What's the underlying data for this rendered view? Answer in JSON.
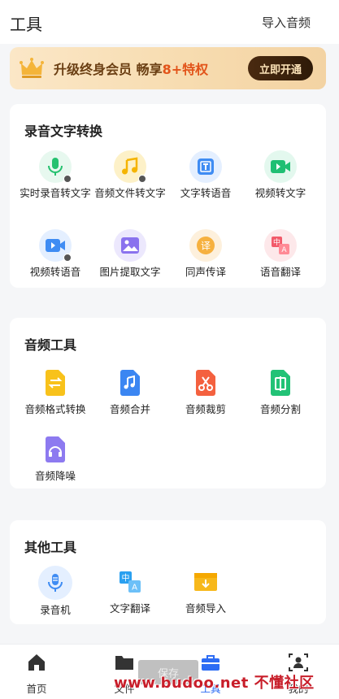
{
  "header": {
    "title": "工具",
    "import_label": "导入音频"
  },
  "banner": {
    "text_a": "升级终身会员 畅享",
    "text_b": "8+特权",
    "button": "立即开通"
  },
  "sections": [
    {
      "title": "录音文字转换",
      "tools": [
        {
          "label": "实时录音转文字",
          "icon": "mic-icon"
        },
        {
          "label": "音频文件转文字",
          "icon": "music-note-icon"
        },
        {
          "label": "文字转语音",
          "icon": "text-to-speech-icon"
        },
        {
          "label": "视频转文字",
          "icon": "video-icon"
        },
        {
          "label": "视频转语音",
          "icon": "video-audio-icon"
        },
        {
          "label": "图片提取文字",
          "icon": "image-icon"
        },
        {
          "label": "同声传译",
          "icon": "interpret-icon"
        },
        {
          "label": "语音翻译",
          "icon": "translate-icon"
        }
      ]
    },
    {
      "title": "音频工具",
      "tools": [
        {
          "label": "音频格式转换",
          "icon": "format-convert-icon"
        },
        {
          "label": "音频合并",
          "icon": "merge-icon"
        },
        {
          "label": "音频裁剪",
          "icon": "scissors-icon"
        },
        {
          "label": "音频分割",
          "icon": "split-icon"
        },
        {
          "label": "音频降噪",
          "icon": "denoise-icon"
        }
      ]
    },
    {
      "title": "其他工具",
      "tools": [
        {
          "label": "录音机",
          "icon": "recorder-icon"
        },
        {
          "label": "文字翻译",
          "icon": "text-translate-icon"
        },
        {
          "label": "音频导入",
          "icon": "import-icon"
        }
      ]
    }
  ],
  "nav": [
    {
      "label": "首页",
      "icon": "home-icon"
    },
    {
      "label": "文件",
      "icon": "folder-icon"
    },
    {
      "label": "工具",
      "icon": "toolbox-icon"
    },
    {
      "label": "我的",
      "icon": "profile-icon"
    }
  ],
  "overlay": {
    "save": "保存",
    "watermark": "www.budoo.net 不懂社区"
  },
  "colors": {
    "accent": "#2d6cf4",
    "banner_highlight": "#e2541a"
  }
}
